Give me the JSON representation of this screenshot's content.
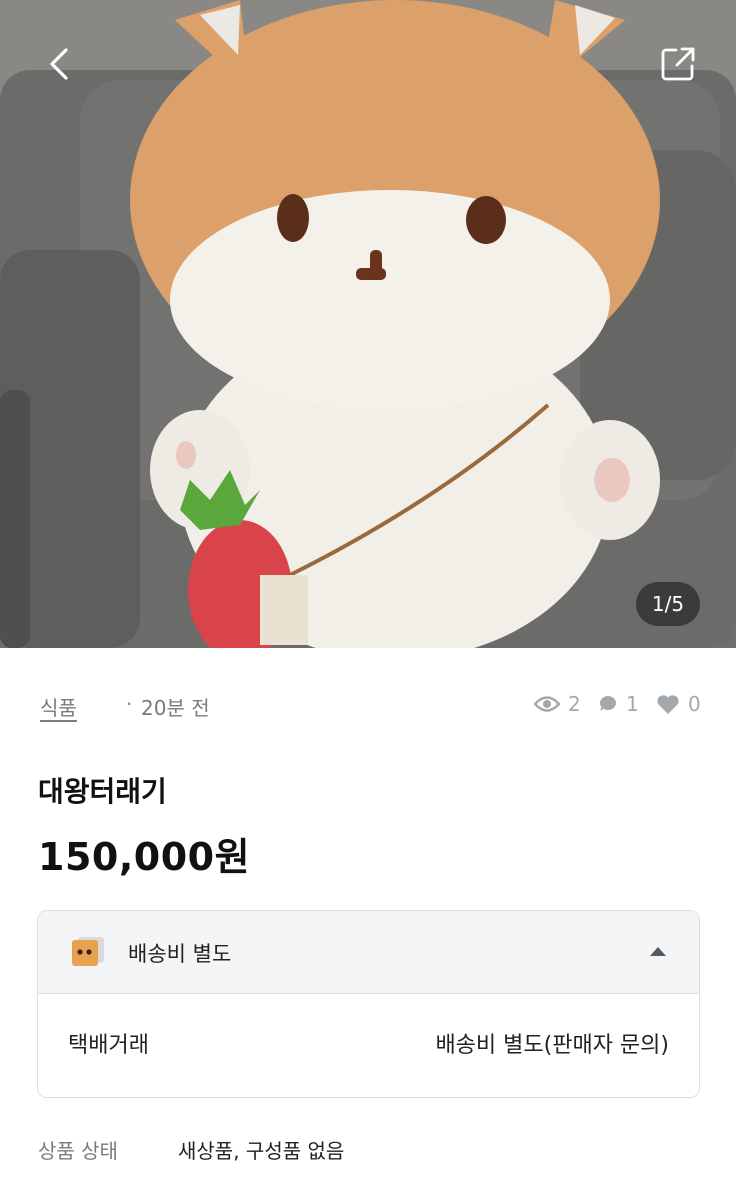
{
  "photo": {
    "alt_icon": "plush-photo",
    "counter": "1/5"
  },
  "toolbar": {
    "back_icon": "chevron-left-icon",
    "share_icon": "share-icon"
  },
  "meta": {
    "category": "식품",
    "separator": "·",
    "time": "20분 전",
    "views": "2",
    "chats": "1",
    "likes": "0"
  },
  "product": {
    "title": "대왕터래기",
    "price": "150,000원"
  },
  "shipping": {
    "header_label": "배송비 별도",
    "method": "택배거래",
    "detail": "배송비 별도(판매자 문의)"
  },
  "condition": {
    "label": "상품 상태",
    "value": "새상품, 구성품 없음"
  },
  "colors": {
    "stat_gray": "#a3a8ad",
    "muted_text": "#7b7b7b",
    "card_border": "#dcdfe3"
  }
}
